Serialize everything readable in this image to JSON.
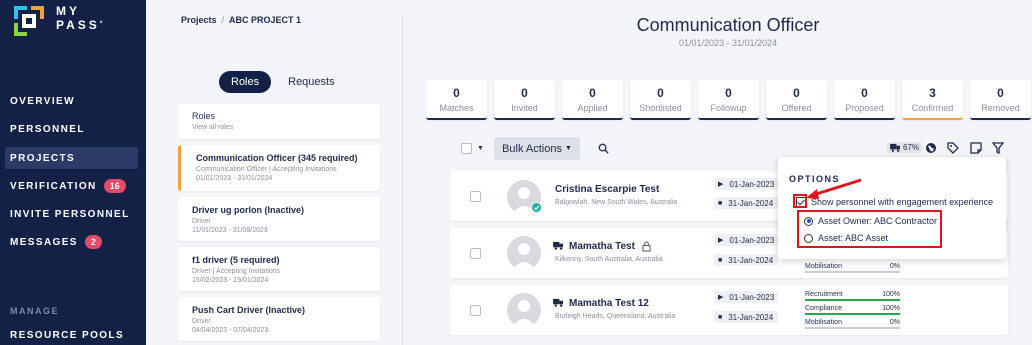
{
  "app": {
    "logo_text_1": "MY",
    "logo_text_2": "PASS",
    "trademark": "°"
  },
  "sidebar": {
    "items": [
      {
        "label": "OVERVIEW"
      },
      {
        "label": "PERSONNEL"
      },
      {
        "label": "PROJECTS"
      },
      {
        "label": "VERIFICATION",
        "badge": "16"
      },
      {
        "label": "INVITE PERSONNEL"
      },
      {
        "label": "MESSAGES",
        "badge": "2"
      }
    ],
    "section_label": "MANAGE",
    "section_items": [
      {
        "label": "RESOURCE POOLS"
      }
    ]
  },
  "breadcrumb": {
    "projects": "Projects",
    "separator": "/",
    "current": "ABC PROJECT 1"
  },
  "toggle": {
    "roles": "Roles",
    "requests": "Requests"
  },
  "roles": [
    {
      "title": "Roles",
      "sub1": "View all roles",
      "sub2": ""
    },
    {
      "title": "Communication Officer (345 required)",
      "sub1": "Communication Officer | Accepting Invitations",
      "sub2": "01/01/2023 - 31/01/2024"
    },
    {
      "title": "Driver ug porlon (Inactive)",
      "sub1": "Driver",
      "sub2": "11/01/2023 - 31/08/2023"
    },
    {
      "title": "f1 driver (5 required)",
      "sub1": "Driver | Accepting Invitations",
      "sub2": "15/02/2023 - 19/01/2024"
    },
    {
      "title": "Push Cart Driver (Inactive)",
      "sub1": "Driver",
      "sub2": "04/04/2023 - 07/04/2023"
    }
  ],
  "header": {
    "title": "Communication Officer",
    "dates": "01/01/2023 - 31/01/2024"
  },
  "stats": [
    {
      "num": "0",
      "label": "Matches"
    },
    {
      "num": "0",
      "label": "Invited"
    },
    {
      "num": "0",
      "label": "Applied"
    },
    {
      "num": "0",
      "label": "Shortlisted"
    },
    {
      "num": "0",
      "label": "Followup"
    },
    {
      "num": "0",
      "label": "Offered"
    },
    {
      "num": "0",
      "label": "Proposed"
    },
    {
      "num": "3",
      "label": "Confirmed"
    },
    {
      "num": "0",
      "label": "Removed"
    }
  ],
  "toolbar": {
    "bulk_actions": "Bulk Actions",
    "fill_percent": "67%"
  },
  "options": {
    "title": "OPTIONS",
    "engagement": "Show personnel with engagement experience",
    "asset_owner": "Asset Owner: ABC Contractor",
    "asset": "Asset: ABC Asset"
  },
  "personnel": [
    {
      "name": "Cristina Escarpie Test",
      "location": "Balgowlah, New South Wales, Australia",
      "start": "01-Jan-2023",
      "end": "31-Jan-2024"
    },
    {
      "name": "Mamatha Test",
      "location": "Kilkenny, South Australia, Australia",
      "start": "01-Jan-2023",
      "end": "31-Jan-2024",
      "metrics": [
        {
          "label": "Mobilisation",
          "value": "0%"
        }
      ]
    },
    {
      "name": "Mamatha Test 12",
      "location": "Burleigh Heads, Queensland, Australia",
      "start": "01-Jan-2023",
      "end": "31-Jan-2024",
      "metrics": [
        {
          "label": "Recruitment",
          "value": "100%"
        },
        {
          "label": "Compliance",
          "value": "100%"
        },
        {
          "label": "Mobilisation",
          "value": "0%"
        }
      ]
    }
  ],
  "colors": {
    "sidebar": "#142147",
    "accent_orange": "#f4a23a",
    "badge_pink": "#e24a68",
    "highlight_red": "#e0141f"
  }
}
